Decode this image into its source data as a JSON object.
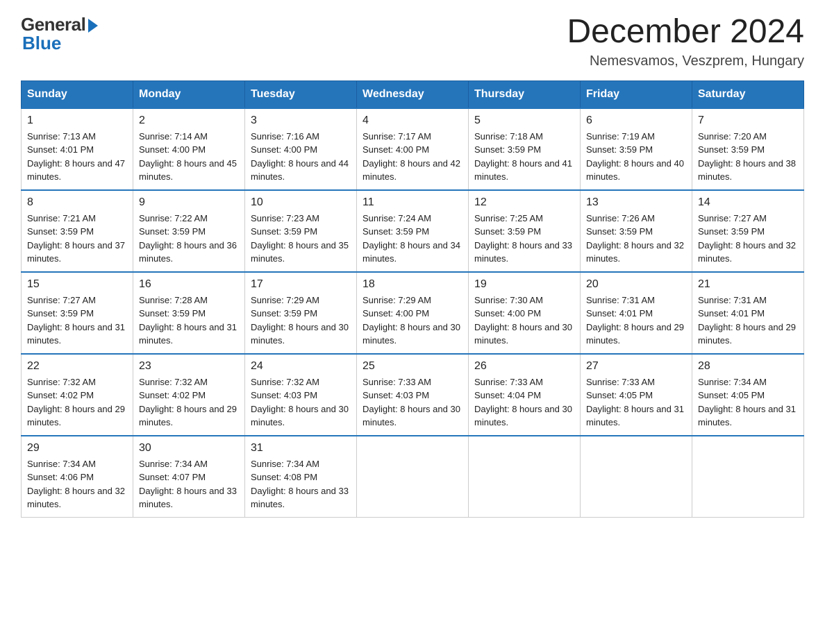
{
  "logo": {
    "general": "General",
    "blue": "Blue"
  },
  "title": "December 2024",
  "subtitle": "Nemesvamos, Veszprem, Hungary",
  "days_of_week": [
    "Sunday",
    "Monday",
    "Tuesday",
    "Wednesday",
    "Thursday",
    "Friday",
    "Saturday"
  ],
  "weeks": [
    [
      {
        "day": "1",
        "sunrise": "7:13 AM",
        "sunset": "4:01 PM",
        "daylight": "8 hours and 47 minutes."
      },
      {
        "day": "2",
        "sunrise": "7:14 AM",
        "sunset": "4:00 PM",
        "daylight": "8 hours and 45 minutes."
      },
      {
        "day": "3",
        "sunrise": "7:16 AM",
        "sunset": "4:00 PM",
        "daylight": "8 hours and 44 minutes."
      },
      {
        "day": "4",
        "sunrise": "7:17 AM",
        "sunset": "4:00 PM",
        "daylight": "8 hours and 42 minutes."
      },
      {
        "day": "5",
        "sunrise": "7:18 AM",
        "sunset": "3:59 PM",
        "daylight": "8 hours and 41 minutes."
      },
      {
        "day": "6",
        "sunrise": "7:19 AM",
        "sunset": "3:59 PM",
        "daylight": "8 hours and 40 minutes."
      },
      {
        "day": "7",
        "sunrise": "7:20 AM",
        "sunset": "3:59 PM",
        "daylight": "8 hours and 38 minutes."
      }
    ],
    [
      {
        "day": "8",
        "sunrise": "7:21 AM",
        "sunset": "3:59 PM",
        "daylight": "8 hours and 37 minutes."
      },
      {
        "day": "9",
        "sunrise": "7:22 AM",
        "sunset": "3:59 PM",
        "daylight": "8 hours and 36 minutes."
      },
      {
        "day": "10",
        "sunrise": "7:23 AM",
        "sunset": "3:59 PM",
        "daylight": "8 hours and 35 minutes."
      },
      {
        "day": "11",
        "sunrise": "7:24 AM",
        "sunset": "3:59 PM",
        "daylight": "8 hours and 34 minutes."
      },
      {
        "day": "12",
        "sunrise": "7:25 AM",
        "sunset": "3:59 PM",
        "daylight": "8 hours and 33 minutes."
      },
      {
        "day": "13",
        "sunrise": "7:26 AM",
        "sunset": "3:59 PM",
        "daylight": "8 hours and 32 minutes."
      },
      {
        "day": "14",
        "sunrise": "7:27 AM",
        "sunset": "3:59 PM",
        "daylight": "8 hours and 32 minutes."
      }
    ],
    [
      {
        "day": "15",
        "sunrise": "7:27 AM",
        "sunset": "3:59 PM",
        "daylight": "8 hours and 31 minutes."
      },
      {
        "day": "16",
        "sunrise": "7:28 AM",
        "sunset": "3:59 PM",
        "daylight": "8 hours and 31 minutes."
      },
      {
        "day": "17",
        "sunrise": "7:29 AM",
        "sunset": "3:59 PM",
        "daylight": "8 hours and 30 minutes."
      },
      {
        "day": "18",
        "sunrise": "7:29 AM",
        "sunset": "4:00 PM",
        "daylight": "8 hours and 30 minutes."
      },
      {
        "day": "19",
        "sunrise": "7:30 AM",
        "sunset": "4:00 PM",
        "daylight": "8 hours and 30 minutes."
      },
      {
        "day": "20",
        "sunrise": "7:31 AM",
        "sunset": "4:01 PM",
        "daylight": "8 hours and 29 minutes."
      },
      {
        "day": "21",
        "sunrise": "7:31 AM",
        "sunset": "4:01 PM",
        "daylight": "8 hours and 29 minutes."
      }
    ],
    [
      {
        "day": "22",
        "sunrise": "7:32 AM",
        "sunset": "4:02 PM",
        "daylight": "8 hours and 29 minutes."
      },
      {
        "day": "23",
        "sunrise": "7:32 AM",
        "sunset": "4:02 PM",
        "daylight": "8 hours and 29 minutes."
      },
      {
        "day": "24",
        "sunrise": "7:32 AM",
        "sunset": "4:03 PM",
        "daylight": "8 hours and 30 minutes."
      },
      {
        "day": "25",
        "sunrise": "7:33 AM",
        "sunset": "4:03 PM",
        "daylight": "8 hours and 30 minutes."
      },
      {
        "day": "26",
        "sunrise": "7:33 AM",
        "sunset": "4:04 PM",
        "daylight": "8 hours and 30 minutes."
      },
      {
        "day": "27",
        "sunrise": "7:33 AM",
        "sunset": "4:05 PM",
        "daylight": "8 hours and 31 minutes."
      },
      {
        "day": "28",
        "sunrise": "7:34 AM",
        "sunset": "4:05 PM",
        "daylight": "8 hours and 31 minutes."
      }
    ],
    [
      {
        "day": "29",
        "sunrise": "7:34 AM",
        "sunset": "4:06 PM",
        "daylight": "8 hours and 32 minutes."
      },
      {
        "day": "30",
        "sunrise": "7:34 AM",
        "sunset": "4:07 PM",
        "daylight": "8 hours and 33 minutes."
      },
      {
        "day": "31",
        "sunrise": "7:34 AM",
        "sunset": "4:08 PM",
        "daylight": "8 hours and 33 minutes."
      },
      null,
      null,
      null,
      null
    ]
  ],
  "labels": {
    "sunrise": "Sunrise:",
    "sunset": "Sunset:",
    "daylight": "Daylight:"
  }
}
